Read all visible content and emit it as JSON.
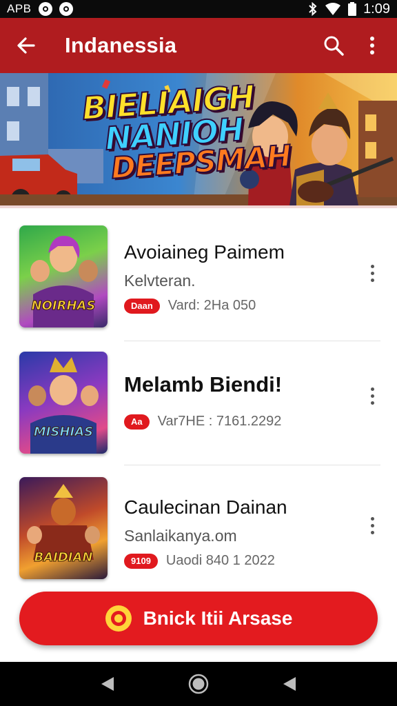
{
  "status_bar": {
    "carrier": "APB",
    "time": "1:09",
    "icons": [
      "notification-icon",
      "notification-icon",
      "bluetooth-icon",
      "wifi-icon",
      "battery-icon"
    ]
  },
  "app_bar": {
    "title": "Indanessia",
    "back_icon": "arrow-back-icon",
    "search_icon": "search-icon",
    "more_icon": "more-vertical-icon"
  },
  "banner": {
    "line1": "BIELIAIGH",
    "line2": "NANIOH",
    "line3": "DEEPSMAH"
  },
  "games": [
    {
      "title": "Avoiaineg Paimem",
      "subtitle": "Kelvteran.",
      "badge": "Daan",
      "meta": "Vard: 2Ha 050",
      "thumb_label": "NOIRHAS"
    },
    {
      "title": "Melamb Biendi!",
      "subtitle": "",
      "badge": "Aa",
      "meta": "Var7HE : 7161.2292",
      "thumb_label": "MISHIAS"
    },
    {
      "title": "Caulecinan Dainan",
      "subtitle": "Sanlaikanya.om",
      "badge": "9109",
      "meta": "Uaodi 840 1 2022",
      "thumb_label": "BAIDIAN"
    }
  ],
  "cta": {
    "label": "Bnick Itii Arsase",
    "icon": "target-icon"
  },
  "nav_bar": {
    "back_icon": "nav-back-icon",
    "home_icon": "nav-home-icon",
    "recents_icon": "nav-recents-icon"
  },
  "colors": {
    "app_bar": "#b01c1f",
    "accent": "#e31b1f",
    "status_bar": "#0b0b0b"
  }
}
